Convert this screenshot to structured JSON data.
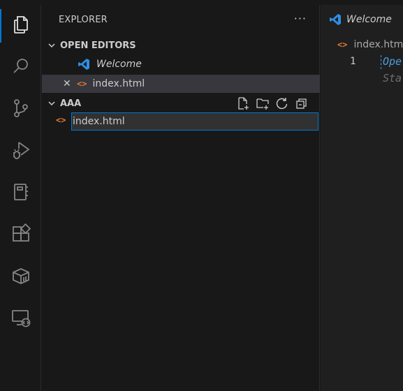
{
  "sidebar": {
    "title": "EXPLORER",
    "more": "···",
    "open_editors": {
      "header": "OPEN EDITORS",
      "items": [
        {
          "label": "Welcome",
          "icon": "vscode-icon"
        },
        {
          "label": "index.html",
          "icon": "html-file-icon",
          "close": "✕"
        }
      ]
    },
    "folder": {
      "header": "AAA",
      "rename_value": "index.html",
      "file_icon_glyph": "<>"
    }
  },
  "editor": {
    "tab_label": "Welcome",
    "breadcrumb": "index.htm",
    "line_number": "1",
    "line1_text": "Ope",
    "line2_text": "Sta"
  },
  "colors": {
    "accent": "#0078d4",
    "html_icon": "#e37933",
    "vscode_blue": "#2d8fe6"
  }
}
